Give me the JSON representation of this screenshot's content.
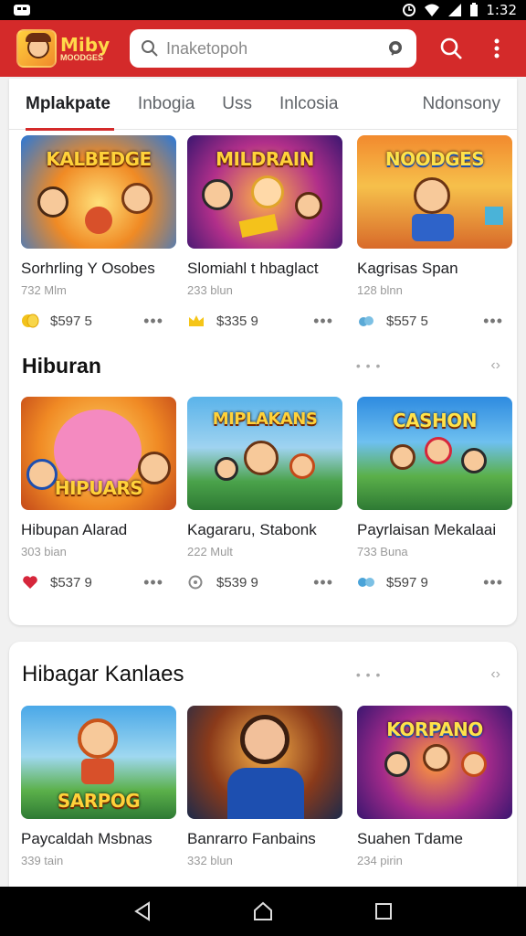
{
  "status_bar": {
    "time": "1:32"
  },
  "header": {
    "logo_title": "Miby",
    "logo_subtitle": "MOODGES",
    "search_placeholder": "Inaketopoh",
    "brand_color": "#d42a2a"
  },
  "tabs": [
    {
      "label": "Mplakpate",
      "active": true
    },
    {
      "label": "Inbogia",
      "active": false
    },
    {
      "label": "Uss",
      "active": false
    },
    {
      "label": "Inlcosia",
      "active": false
    },
    {
      "label": "Ndonsony",
      "active": false
    }
  ],
  "section1": {
    "cards": [
      {
        "thumb_title": "KALBEDGE",
        "title": "Sorhrling Y Osobes",
        "subtitle": "732 Mlm",
        "price": "$597 5",
        "coin_icon": "coin-icon",
        "coin_color": "#f2c21b"
      },
      {
        "thumb_title": "MILDRAIN",
        "title": "Slomiahl t hbaglact",
        "subtitle": "233 blun",
        "price": "$335 9",
        "coin_icon": "crown-icon",
        "coin_color": "#f5c518"
      },
      {
        "thumb_title": "NOODGES",
        "title": "Kagrisas Span",
        "subtitle": "128 blnn",
        "price": "$557 5",
        "coin_icon": "cloud-icon",
        "coin_color": "#5aa9d6"
      }
    ]
  },
  "section2": {
    "title": "Hiburan",
    "cards": [
      {
        "thumb_title": "HIPUARS",
        "title": "Hibupan Alarad",
        "subtitle": "303 bian",
        "price": "$537 9",
        "coin_icon": "heart-icon",
        "coin_color": "#d6263b"
      },
      {
        "thumb_title": "MIPLAKANS",
        "title": "Kagararu, Stabonk",
        "subtitle": "222 Mult",
        "price": "$539 9",
        "coin_icon": "clock-icon",
        "coin_color": "#888888"
      },
      {
        "thumb_title": "CASHON",
        "title": "Payrlaisan Mekalaai",
        "subtitle": "733 Buna",
        "price": "$597 9",
        "coin_icon": "gamepad-icon",
        "coin_color": "#4aa3d8"
      }
    ]
  },
  "section3": {
    "title": "Hibagar Kanlaes",
    "cards": [
      {
        "thumb_title": "SARPOG",
        "title": "Paycaldah Msbnas",
        "subtitle": "339 tain"
      },
      {
        "thumb_title": "",
        "title": "Banrarro Fanbains",
        "subtitle": "332 blun"
      },
      {
        "thumb_title": "KORPANO",
        "title": "Suahen Tdame",
        "subtitle": "234 pirin"
      }
    ]
  },
  "more_label": "•••",
  "sec_dots": "• • •",
  "sec_arrow": "‹›"
}
